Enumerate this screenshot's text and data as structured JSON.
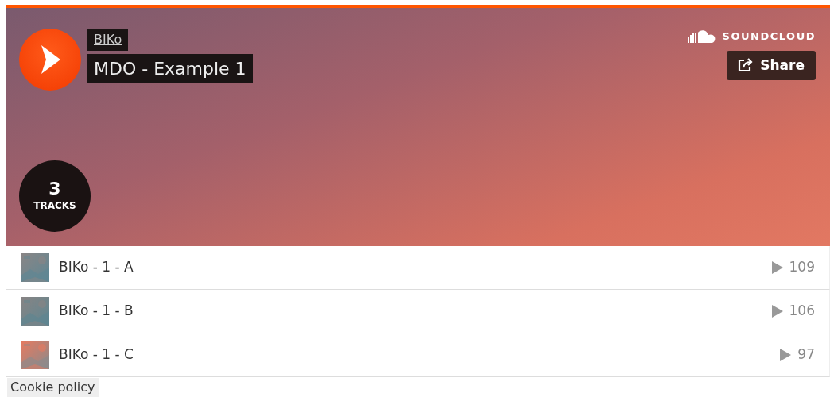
{
  "player": {
    "artist": "BIKo",
    "title": "MDO - Example 1",
    "brand": "SOUNDCLOUD",
    "share_button": "Share",
    "track_count": "3",
    "track_count_label": "TRACKS"
  },
  "tracks": [
    {
      "title": "BIKo - 1 - A",
      "plays": "109"
    },
    {
      "title": "BIKo - 1 - B",
      "plays": "106"
    },
    {
      "title": "BIKo - 1 - C",
      "plays": "97"
    }
  ],
  "cookie_link": "Cookie policy"
}
